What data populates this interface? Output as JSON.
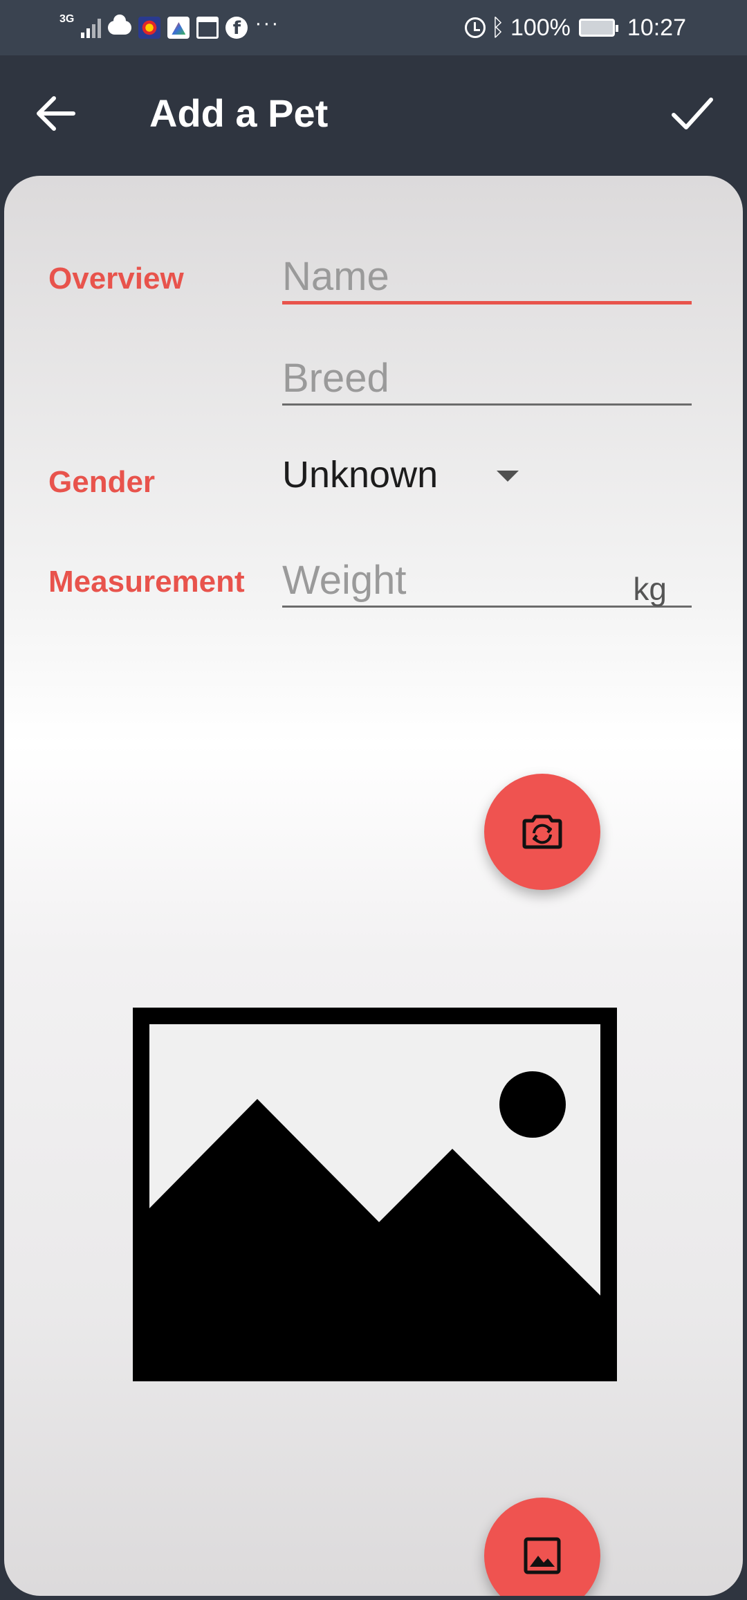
{
  "status_bar": {
    "network": "3G",
    "battery": "100%",
    "time": "10:27",
    "more": "···"
  },
  "app_bar": {
    "title": "Add a Pet"
  },
  "form": {
    "overview_label": "Overview",
    "name_placeholder": "Name",
    "breed_placeholder": "Breed",
    "gender_label": "Gender",
    "gender_value": "Unknown",
    "measurement_label": "Measurement",
    "weight_placeholder": "Weight",
    "weight_unit": "kg"
  },
  "colors": {
    "accent": "#e8534c",
    "fab": "#ef5350",
    "app_bar": "#2f3540"
  },
  "icons": {
    "back": "arrow-left-icon",
    "save": "check-icon",
    "camera": "camera-switch-icon",
    "gallery": "image-icon",
    "placeholder": "image-placeholder-icon"
  }
}
